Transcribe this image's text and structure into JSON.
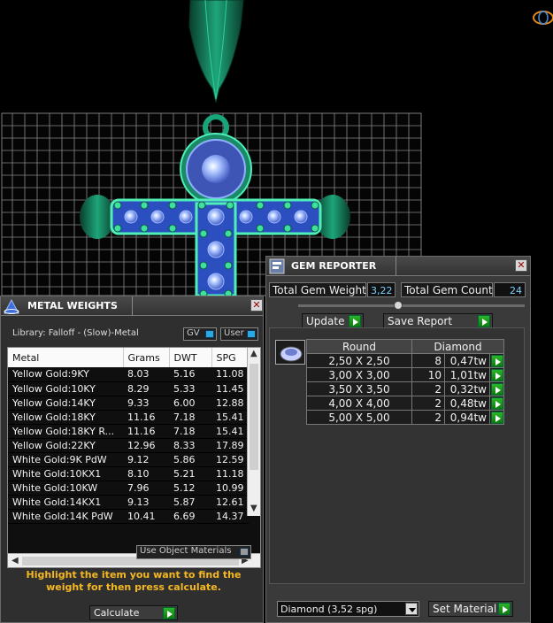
{
  "gem_reporter": {
    "title": "GEM REPORTER",
    "total_weight_label": "Total Gem Weight",
    "total_weight_value": "3,22",
    "total_count_label": "Total Gem Count",
    "total_count_value": "24",
    "update_label": "Update",
    "save_report_label": "Save Report",
    "table": {
      "headers": [
        "Round",
        "Diamond"
      ],
      "rows": [
        {
          "size": "2,50 X 2,50",
          "count": "8",
          "weight": "0,47tw"
        },
        {
          "size": "3,00 X 3,00",
          "count": "10",
          "weight": "1,01tw"
        },
        {
          "size": "3,50 X 3,50",
          "count": "2",
          "weight": "0,32tw"
        },
        {
          "size": "4,00 X 4,00",
          "count": "2",
          "weight": "0,48tw"
        },
        {
          "size": "5,00 X 5,00",
          "count": "2",
          "weight": "0,94tw"
        }
      ]
    },
    "material_select": "Diamond    (3,52 spg)",
    "set_material_label": "Set Material"
  },
  "metal_weights": {
    "title": "METAL WEIGHTS",
    "library_label": "Library: Falloff - (Slow)-Metal",
    "gv_label": "GV",
    "user_label": "User",
    "columns": [
      "Metal",
      "Grams",
      "DWT",
      "SPG"
    ],
    "rows": [
      [
        "Yellow Gold:9KY",
        "8.03",
        "5.16",
        "11.08"
      ],
      [
        "Yellow Gold:10KY",
        "8.29",
        "5.33",
        "11.45"
      ],
      [
        "Yellow Gold:14KY",
        "9.33",
        "6.00",
        "12.88"
      ],
      [
        "Yellow Gold:18KY",
        "11.16",
        "7.18",
        "15.41"
      ],
      [
        "Yellow Gold:18KY R...",
        "11.16",
        "7.18",
        "15.41"
      ],
      [
        "Yellow Gold:22KY",
        "12.96",
        "8.33",
        "17.89"
      ],
      [
        "White Gold:9K PdW",
        "9.12",
        "5.86",
        "12.59"
      ],
      [
        "White Gold:10KX1",
        "8.10",
        "5.21",
        "11.18"
      ],
      [
        "White Gold:10KW",
        "7.96",
        "5.12",
        "10.99"
      ],
      [
        "White Gold:14KX1",
        "9.13",
        "5.87",
        "12.61"
      ],
      [
        "White Gold:14K PdW",
        "10.41",
        "6.69",
        "14.37"
      ]
    ],
    "use_object_materials_label": "Use Object Materials",
    "instructions": "Highlight the item you want to find the weight for then press calculate.",
    "calculate_label": "Calculate"
  },
  "colors": {
    "metal_green": "#0e6b4e",
    "gem_blue": "#8fb0ff",
    "accent_yellow": "#f5b822",
    "value_blue": "#7fd0ff",
    "go_green": "#1a9a1a"
  }
}
